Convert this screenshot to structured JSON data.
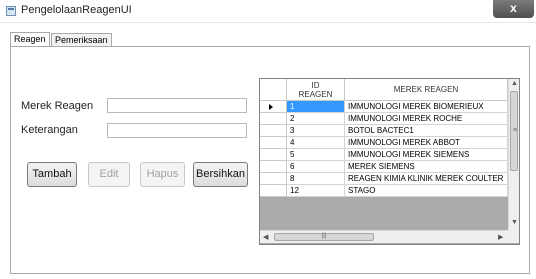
{
  "window": {
    "title": "PengelolaanReagenUI",
    "close_label": "x"
  },
  "tabs": [
    {
      "label": "Reagen",
      "active": true
    },
    {
      "label": "Pemeriksaan",
      "active": false
    }
  ],
  "form": {
    "merek_label": "Merek Reagen",
    "merek_value": "",
    "keterangan_label": "Keterangan",
    "keterangan_value": ""
  },
  "buttons": {
    "tambah": "Tambah",
    "edit": "Edit",
    "hapus": "Hapus",
    "bersihkan": "Bersihkan"
  },
  "grid": {
    "columns": [
      "ID\nREAGEN",
      "MEREK REAGEN"
    ],
    "rows": [
      {
        "id": "1",
        "merek": "IMMUNOLOGI MEREK BIOMERIEUX"
      },
      {
        "id": "2",
        "merek": "IMMUNOLOGI MEREK ROCHE"
      },
      {
        "id": "3",
        "merek": "BOTOL BACTEC1"
      },
      {
        "id": "4",
        "merek": "IMMUNOLOGI MEREK ABBOT"
      },
      {
        "id": "5",
        "merek": "IMMUNOLOGI MEREK SIEMENS"
      },
      {
        "id": "6",
        "merek": "MEREK SIEMENS"
      },
      {
        "id": "8",
        "merek": "REAGEN KIMIA KLINIK MEREK COULTER"
      },
      {
        "id": "12",
        "merek": "STAGO"
      }
    ],
    "selected_row": 0
  },
  "icons": {
    "close": "close-icon",
    "row_selector": "row-selector-arrow-icon",
    "scroll_up": "scroll-up-icon",
    "scroll_down": "scroll-down-icon",
    "scroll_left": "scroll-left-icon",
    "scroll_right": "scroll-right-icon"
  },
  "colors": {
    "selection": "#3399ff",
    "title_close": "#5a5a5a"
  }
}
